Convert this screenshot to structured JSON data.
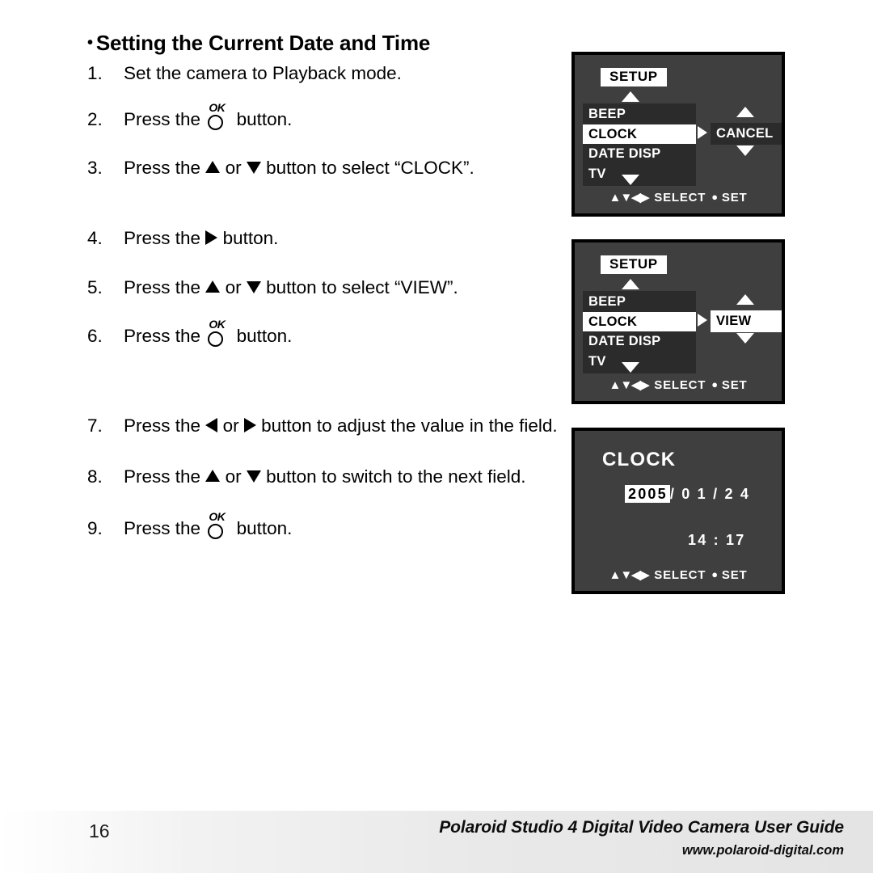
{
  "page": {
    "heading": "Setting the Current Date and Time",
    "bullet": "•"
  },
  "steps": [
    {
      "num": "1.",
      "text_before": "Set the camera to Playback mode.",
      "text_after": ""
    },
    {
      "num": "2.",
      "text_before": "Press the",
      "text_after": "button."
    },
    {
      "num": "3.",
      "text_before": "Press the",
      "text_mid": "or",
      "text_after": "button to select “CLOCK”."
    },
    {
      "num": "4.",
      "text_before": "Press the",
      "text_after": "button."
    },
    {
      "num": "5.",
      "text_before": "Press the",
      "text_mid": "or",
      "text_after": "button to select “VIEW”."
    },
    {
      "num": "6.",
      "text_before": "Press the",
      "text_after": "button."
    },
    {
      "num": "7.",
      "text_before": "Press the",
      "text_mid": "or",
      "text_after": "button to adjust the value in the field."
    },
    {
      "num": "8.",
      "text_before": "Press the",
      "text_mid": "or",
      "text_after": "button to switch to the next field."
    },
    {
      "num": "9.",
      "text_before": "Press the",
      "text_after": "button."
    }
  ],
  "ok_button_label": "OK",
  "screens": {
    "menu_cancel": {
      "title": "SETUP",
      "items": [
        {
          "label": "BEEP",
          "selected": false
        },
        {
          "label": "CLOCK",
          "selected": true
        },
        {
          "label": "DATE DISP",
          "selected": false
        },
        {
          "label": "TV",
          "selected": false
        }
      ],
      "submenu_value": "CANCEL",
      "submenu_highlighted": false,
      "hint_glyphs": "▲▼◀▶",
      "hint_select": "SELECT",
      "hint_dot": "●",
      "hint_set": "SET"
    },
    "menu_view": {
      "title": "SETUP",
      "items": [
        {
          "label": "BEEP",
          "selected": false
        },
        {
          "label": "CLOCK",
          "selected": true
        },
        {
          "label": "DATE DISP",
          "selected": false
        },
        {
          "label": "TV",
          "selected": false
        }
      ],
      "submenu_value": "VIEW",
      "submenu_highlighted": true,
      "hint_glyphs": "▲▼◀▶",
      "hint_select": "SELECT",
      "hint_dot": "●",
      "hint_set": "SET"
    },
    "clock": {
      "title": "CLOCK",
      "year": "2005",
      "date_rest": "/ 0 1 / 2 4",
      "time": "14 : 17",
      "hint_glyphs": "▲▼◀▶",
      "hint_select": "SELECT",
      "hint_dot": "●",
      "hint_set": "SET"
    }
  },
  "footer": {
    "page_number": "16",
    "guide_title": "Polaroid Studio 4 Digital Video Camera User Guide",
    "site_url": "www.polaroid-digital.com"
  }
}
